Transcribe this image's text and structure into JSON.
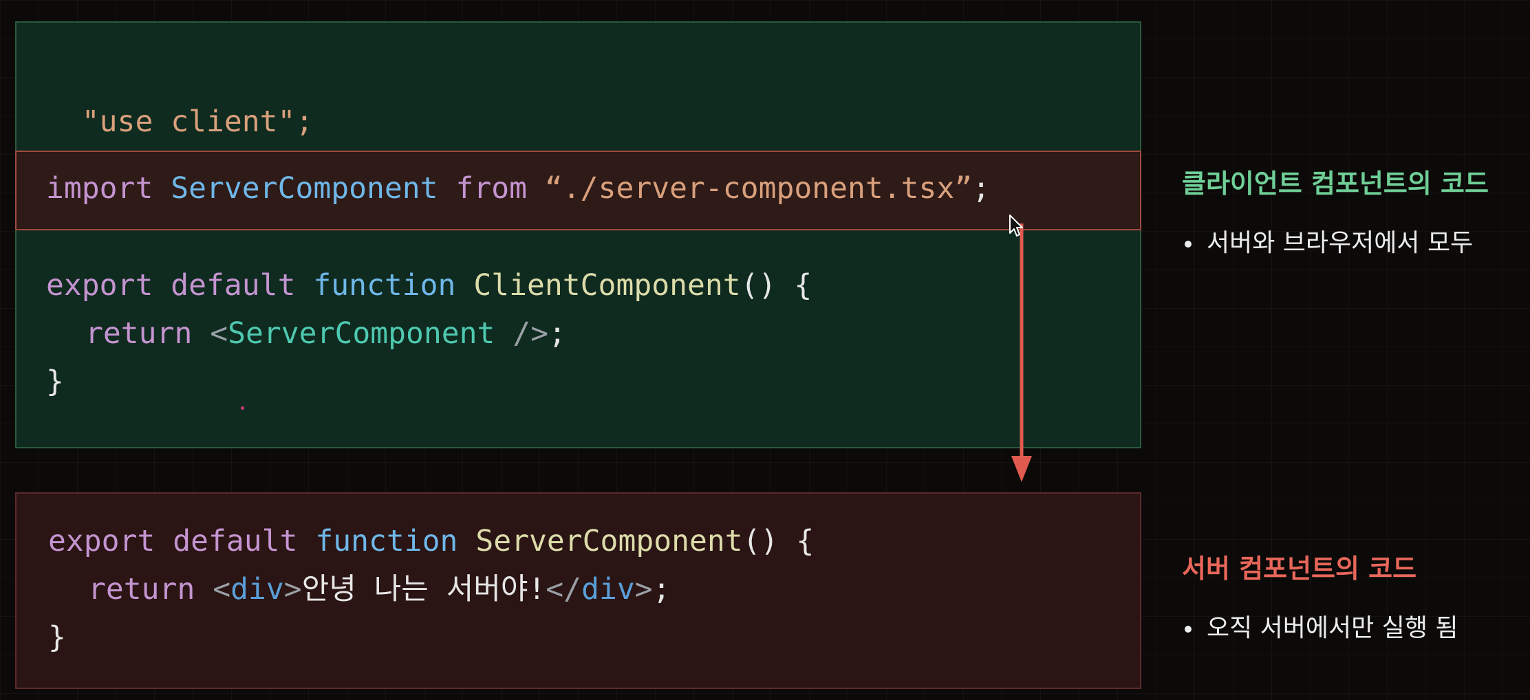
{
  "client_code": {
    "directive": "\"use client\";",
    "import_kw": "import",
    "import_name": "ServerComponent",
    "import_from": "from",
    "import_path": "“./server-component.tsx”",
    "import_semi": ";",
    "export_kw": "export",
    "default_kw": "default",
    "function_kw": "function",
    "fn_name": "ClientComponent",
    "fn_paren": "() {",
    "return_kw": "return",
    "jsx_open": "<",
    "jsx_tag": "ServerComponent",
    "jsx_close": " />",
    "jsx_semi": ";",
    "close_brace": "}"
  },
  "server_code": {
    "export_kw": "export",
    "default_kw": "default",
    "function_kw": "function",
    "fn_name": "ServerComponent",
    "fn_paren": "() {",
    "return_kw": "return",
    "div_open_lt": "<",
    "div_open_tag": "div",
    "div_open_gt": ">",
    "div_text": "안녕 나는 서버야!",
    "div_close_lt": "</",
    "div_close_tag": "div",
    "div_close_gt": ">",
    "semi": ";",
    "close_brace": "}"
  },
  "client_note": {
    "title": "클라이언트 컴포넌트의 코드",
    "bullet": "서버와 브라우저에서 모두"
  },
  "server_note": {
    "title": "서버 컴포넌트의 코드",
    "bullet": "오직 서버에서만 실행 됨"
  },
  "colors": {
    "client_accent": "#6fcf97",
    "server_accent": "#e8675a",
    "arrow": "#e05a4f"
  }
}
